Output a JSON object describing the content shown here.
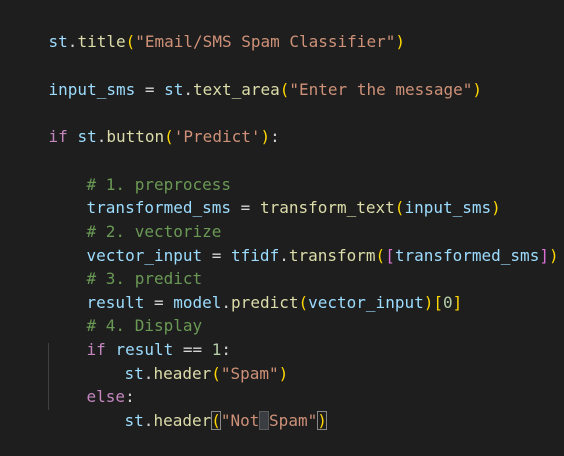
{
  "code_lines": [
    "st.title(\"Email/SMS Spam Classifier\")",
    "",
    "input_sms = st.text_area(\"Enter the message\")",
    "",
    "if st.button('Predict'):",
    "",
    "    # 1. preprocess",
    "    transformed_sms = transform_text(input_sms)",
    "    # 2. vectorize",
    "    vector_input = tfidf.transform([transformed_sms])",
    "    # 3. predict",
    "    result = model.predict(vector_input)[0]",
    "    # 4. Display",
    "    if result == 1:",
    "        st.header(\"Spam\")",
    "    else:",
    "        st.header(\"Not Spam\")"
  ],
  "tokens": {
    "l0": [
      "st",
      ".",
      "title",
      "(",
      "\"Email/SMS Spam Classifier\"",
      ")"
    ],
    "l2": [
      "input_sms",
      " = ",
      "st",
      ".",
      "text_area",
      "(",
      "\"Enter the message\"",
      ")"
    ],
    "l4": [
      "if",
      " ",
      "st",
      ".",
      "button",
      "(",
      "'Predict'",
      ")",
      ":"
    ],
    "l6": [
      "# 1. preprocess"
    ],
    "l7": [
      "transformed_sms",
      " = ",
      "transform_text",
      "(",
      "input_sms",
      ")"
    ],
    "l8": [
      "# 2. vectorize"
    ],
    "l9": [
      "vector_input",
      " = ",
      "tfidf",
      ".",
      "transform",
      "(",
      "[",
      "transformed_sms",
      "]",
      ")"
    ],
    "l10": [
      "# 3. predict"
    ],
    "l11": [
      "result",
      " = ",
      "model",
      ".",
      "predict",
      "(",
      "vector_input",
      ")",
      "[",
      "0",
      "]"
    ],
    "l12": [
      "# 4. Display"
    ],
    "l13": [
      "if",
      " ",
      "result",
      " == ",
      "1",
      ":"
    ],
    "l14": [
      "st",
      ".",
      "header",
      "(",
      "\"Spam\"",
      ")"
    ],
    "l15": [
      "else",
      ":"
    ],
    "l16": [
      "st",
      ".",
      "header",
      "(",
      "\"Not",
      " ",
      "Spam\"",
      ")"
    ]
  },
  "colors": {
    "background": "#1e1e1e",
    "variable": "#9cdcfe",
    "function": "#dcdcaa",
    "string": "#ce9178",
    "keyword": "#c586c0",
    "number": "#b5cea8",
    "comment": "#6a9955",
    "bracket_level1": "#ffd700",
    "bracket_level2": "#da70d6",
    "bracket_level3": "#179fff"
  }
}
